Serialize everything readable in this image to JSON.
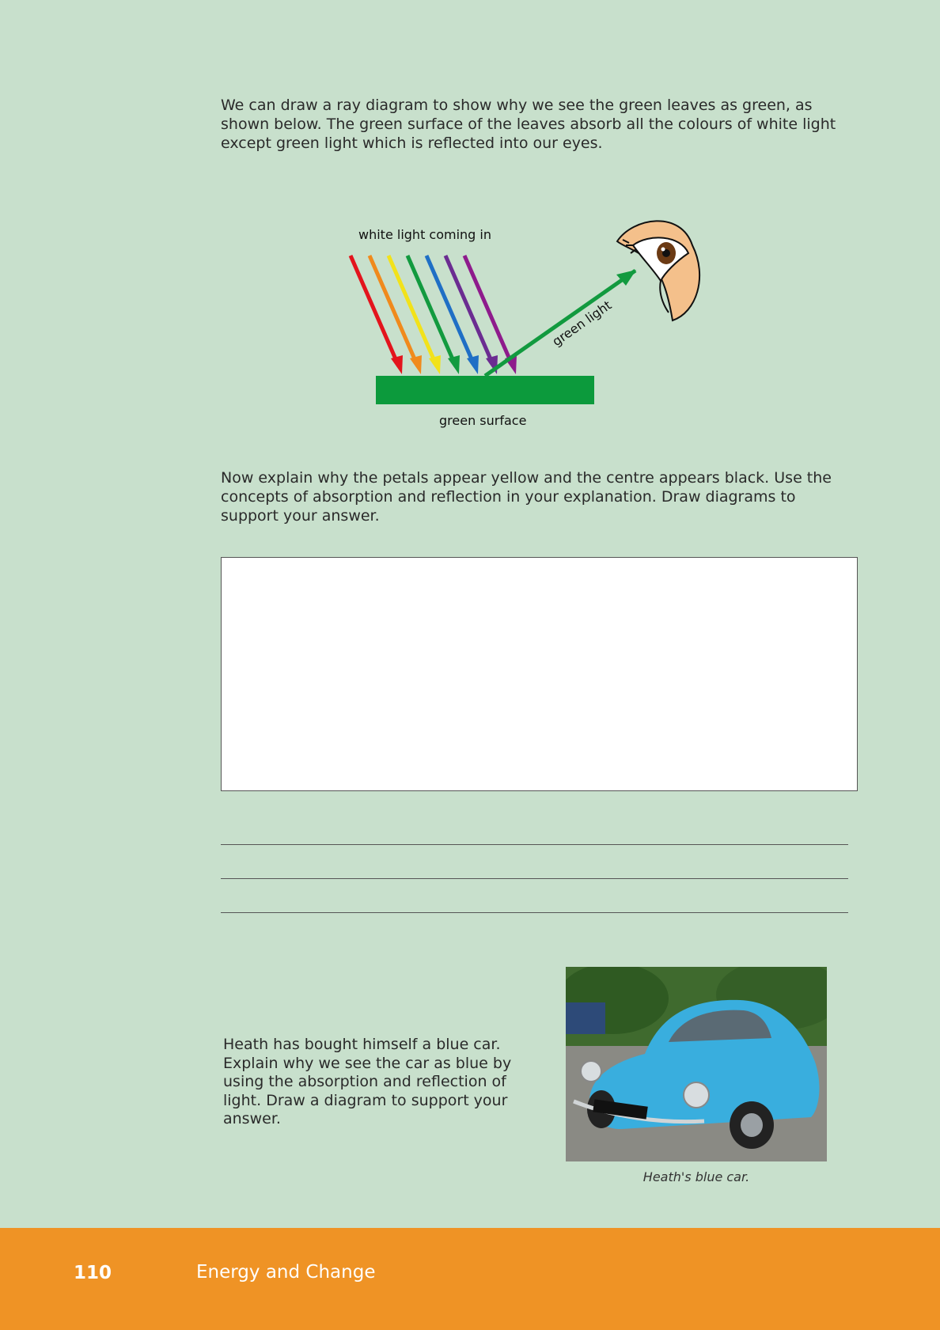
{
  "content": {
    "intro_text": "We can draw a ray diagram to show why we see the green leaves as green, as shown below. The green surface of the leaves absorb all the colours of white light except green light which is reflected into our eyes.",
    "question_text": "Now explain why the petals appear yellow and the centre appears black. Use the concepts of absorption and reflection in your explanation. Draw diagrams to support your answer."
  },
  "diagram": {
    "incoming_label": "white light coming in",
    "reflected_label": "green light",
    "surface_label": "green surface",
    "ray_colors": [
      "#e3141d",
      "#f08a1c",
      "#f2e21a",
      "#129a3f",
      "#1f6fc5",
      "#6b2c91",
      "#8e1b8c"
    ],
    "surface_color": "#0c9a3c"
  },
  "car_question": {
    "text": "Heath has bought himself a blue car. Explain why we see the car as blue by using the absorption and reflection of light. Draw a diagram to support your answer.",
    "caption": "Heath's blue car."
  },
  "footer": {
    "page_number": "110",
    "title": "Energy and Change"
  }
}
